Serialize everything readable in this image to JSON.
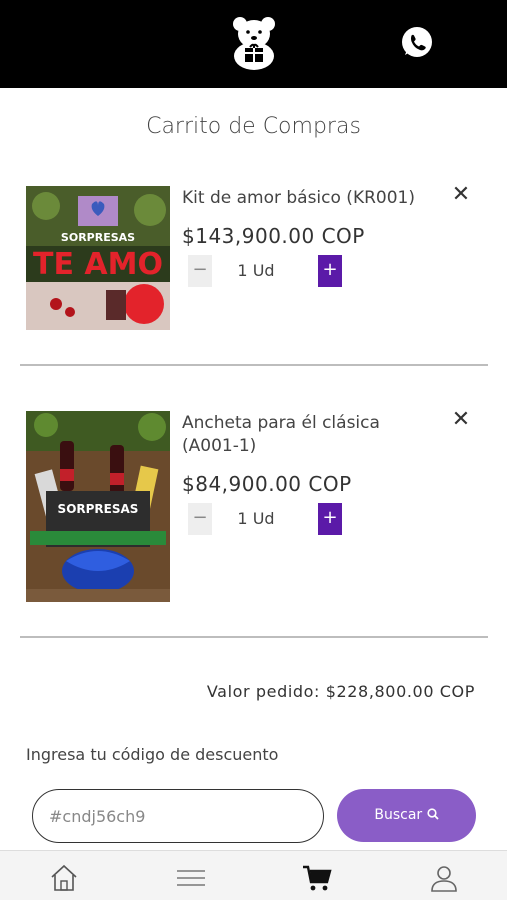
{
  "header": {
    "logo_icon": "bear-gift-logo-icon",
    "whatsapp_icon": "whatsapp-icon"
  },
  "page": {
    "title": "Carrito de Compras"
  },
  "cart": {
    "items": [
      {
        "name": "Kit de amor básico (KR001)",
        "price": "$143,900.00 COP",
        "qty_minus": "−",
        "qty": "1 Ud",
        "qty_plus": "+",
        "remove": "✕",
        "image_text": [
          "SORPRESAS",
          "TE AMO"
        ]
      },
      {
        "name": "Ancheta para él clásica (A001-1)",
        "price": "$84,900.00 COP",
        "qty_minus": "−",
        "qty": "1 Ud",
        "qty_plus": "+",
        "remove": "✕",
        "image_text": [
          "SORPRESAS"
        ]
      }
    ],
    "total_label": "Valor pedido: $228,800.00 COP"
  },
  "discount": {
    "label": "Ingresa tu código de descuento",
    "input_value": "#cndj56ch9",
    "button_label": "Buscar"
  },
  "nav": {
    "items": [
      "home-icon",
      "menu-icon",
      "cart-icon",
      "user-icon"
    ]
  },
  "colors": {
    "header_bg": "#000000",
    "accent": "#5b1aa8",
    "button": "#8a5dc7"
  }
}
